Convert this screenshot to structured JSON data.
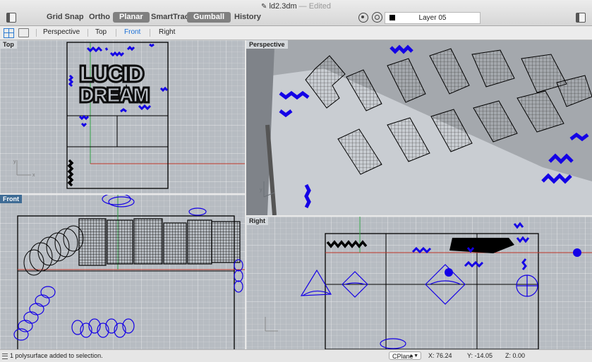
{
  "window": {
    "filename": "ld2.3dm",
    "separator": " — ",
    "status": "Edited",
    "file_glyph": "✎"
  },
  "toolbar": {
    "toggles": [
      {
        "label": "Grid Snap",
        "on": false
      },
      {
        "label": "Ortho",
        "on": false
      },
      {
        "label": "Planar",
        "on": true
      },
      {
        "label": "SmartTrack",
        "on": false
      },
      {
        "label": "Gumball",
        "on": true
      },
      {
        "label": "History",
        "on": false
      }
    ],
    "layer": {
      "name": "Layer 05",
      "color": "#000000"
    }
  },
  "tabs": {
    "items": [
      {
        "label": "Perspective",
        "active": false
      },
      {
        "label": "Top",
        "active": false
      },
      {
        "label": "Front",
        "active": true
      },
      {
        "label": "Right",
        "active": false
      }
    ]
  },
  "viewports": {
    "top": {
      "label": "Top",
      "active": false,
      "axis_x": "x",
      "axis_y": "y"
    },
    "perspective": {
      "label": "Perspective",
      "active": false,
      "axis_y": "y"
    },
    "front": {
      "label": "Front",
      "active": true
    },
    "right": {
      "label": "Right",
      "active": false
    }
  },
  "colors": {
    "curve_blue": "#1400e6",
    "object_black": "#000000",
    "x_axis": "#c0392b",
    "y_axis": "#2e9e44",
    "active_label": "#3f6c95"
  },
  "model_text": {
    "line1": "LUCID",
    "line2": "DREAM"
  },
  "statusbar": {
    "message": "1 polysurface added to selection.",
    "cplane": "CPlane",
    "x": "X: 76.24",
    "y": "Y: -14.05",
    "z": "Z: 0.00"
  }
}
